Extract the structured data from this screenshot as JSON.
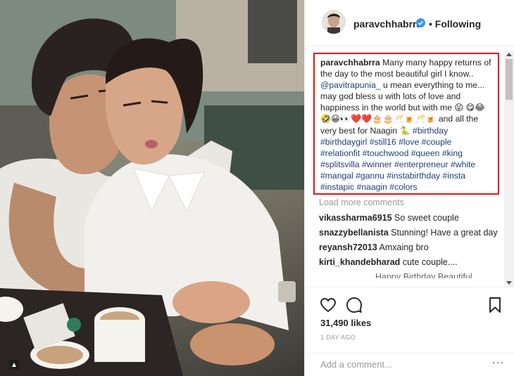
{
  "post": {
    "username": "paravchhabrra",
    "follow_separator": "•",
    "follow_status": "Following"
  },
  "caption": {
    "username": "paravchhabrra",
    "text_1": "Many many happy returns of the day to the most beautiful girl I know..",
    "mention": "@pavitrapunia_",
    "text_2": "u mean everything to me... may god bless u with lots of love and happiness in the world but with me",
    "emoji_1": "😝",
    "emoji_row": "😋😂🤣😀👀❤️❤️🎂🎂🥂🍺🥂🍺",
    "text_3": "and all the very best for Naagin",
    "emoji_2": "🐍",
    "hashtags": [
      "#birthday",
      "#birthdaygirl",
      "#still16",
      "#love",
      "#couple",
      "#relationfit",
      "#touchwood",
      "#queen",
      "#king",
      "#splitsvilla",
      "#winner",
      "#enterpreneur",
      "#white",
      "#mangal",
      "#gannu",
      "#instabirthday",
      "#insta",
      "#instapic",
      "#naagin",
      "#colors"
    ]
  },
  "comments": {
    "load_more": "Load more comments",
    "items": [
      {
        "user": "vikassharma6915",
        "text": "So sweet couple"
      },
      {
        "user": "snazzybellanista",
        "text": "Stunning! Have a great day"
      },
      {
        "user": "reyansh72013",
        "text": "Amxaing bro"
      },
      {
        "user": "kirti_khandebharad",
        "text": "cute couple...."
      }
    ],
    "partial": "Happy Birthday Beautiful"
  },
  "actions": {
    "likes": "31,490 likes",
    "time": "1 DAY AGO"
  },
  "composer": {
    "placeholder": "Add a comment...",
    "more": "···"
  },
  "colors": {
    "highlight_border": "#e0161b",
    "link": "#1a3f7c",
    "verified": "#3897f0"
  },
  "icons": [
    "heart-icon",
    "comment-icon",
    "bookmark-icon",
    "verified-icon",
    "carousel-icon"
  ]
}
